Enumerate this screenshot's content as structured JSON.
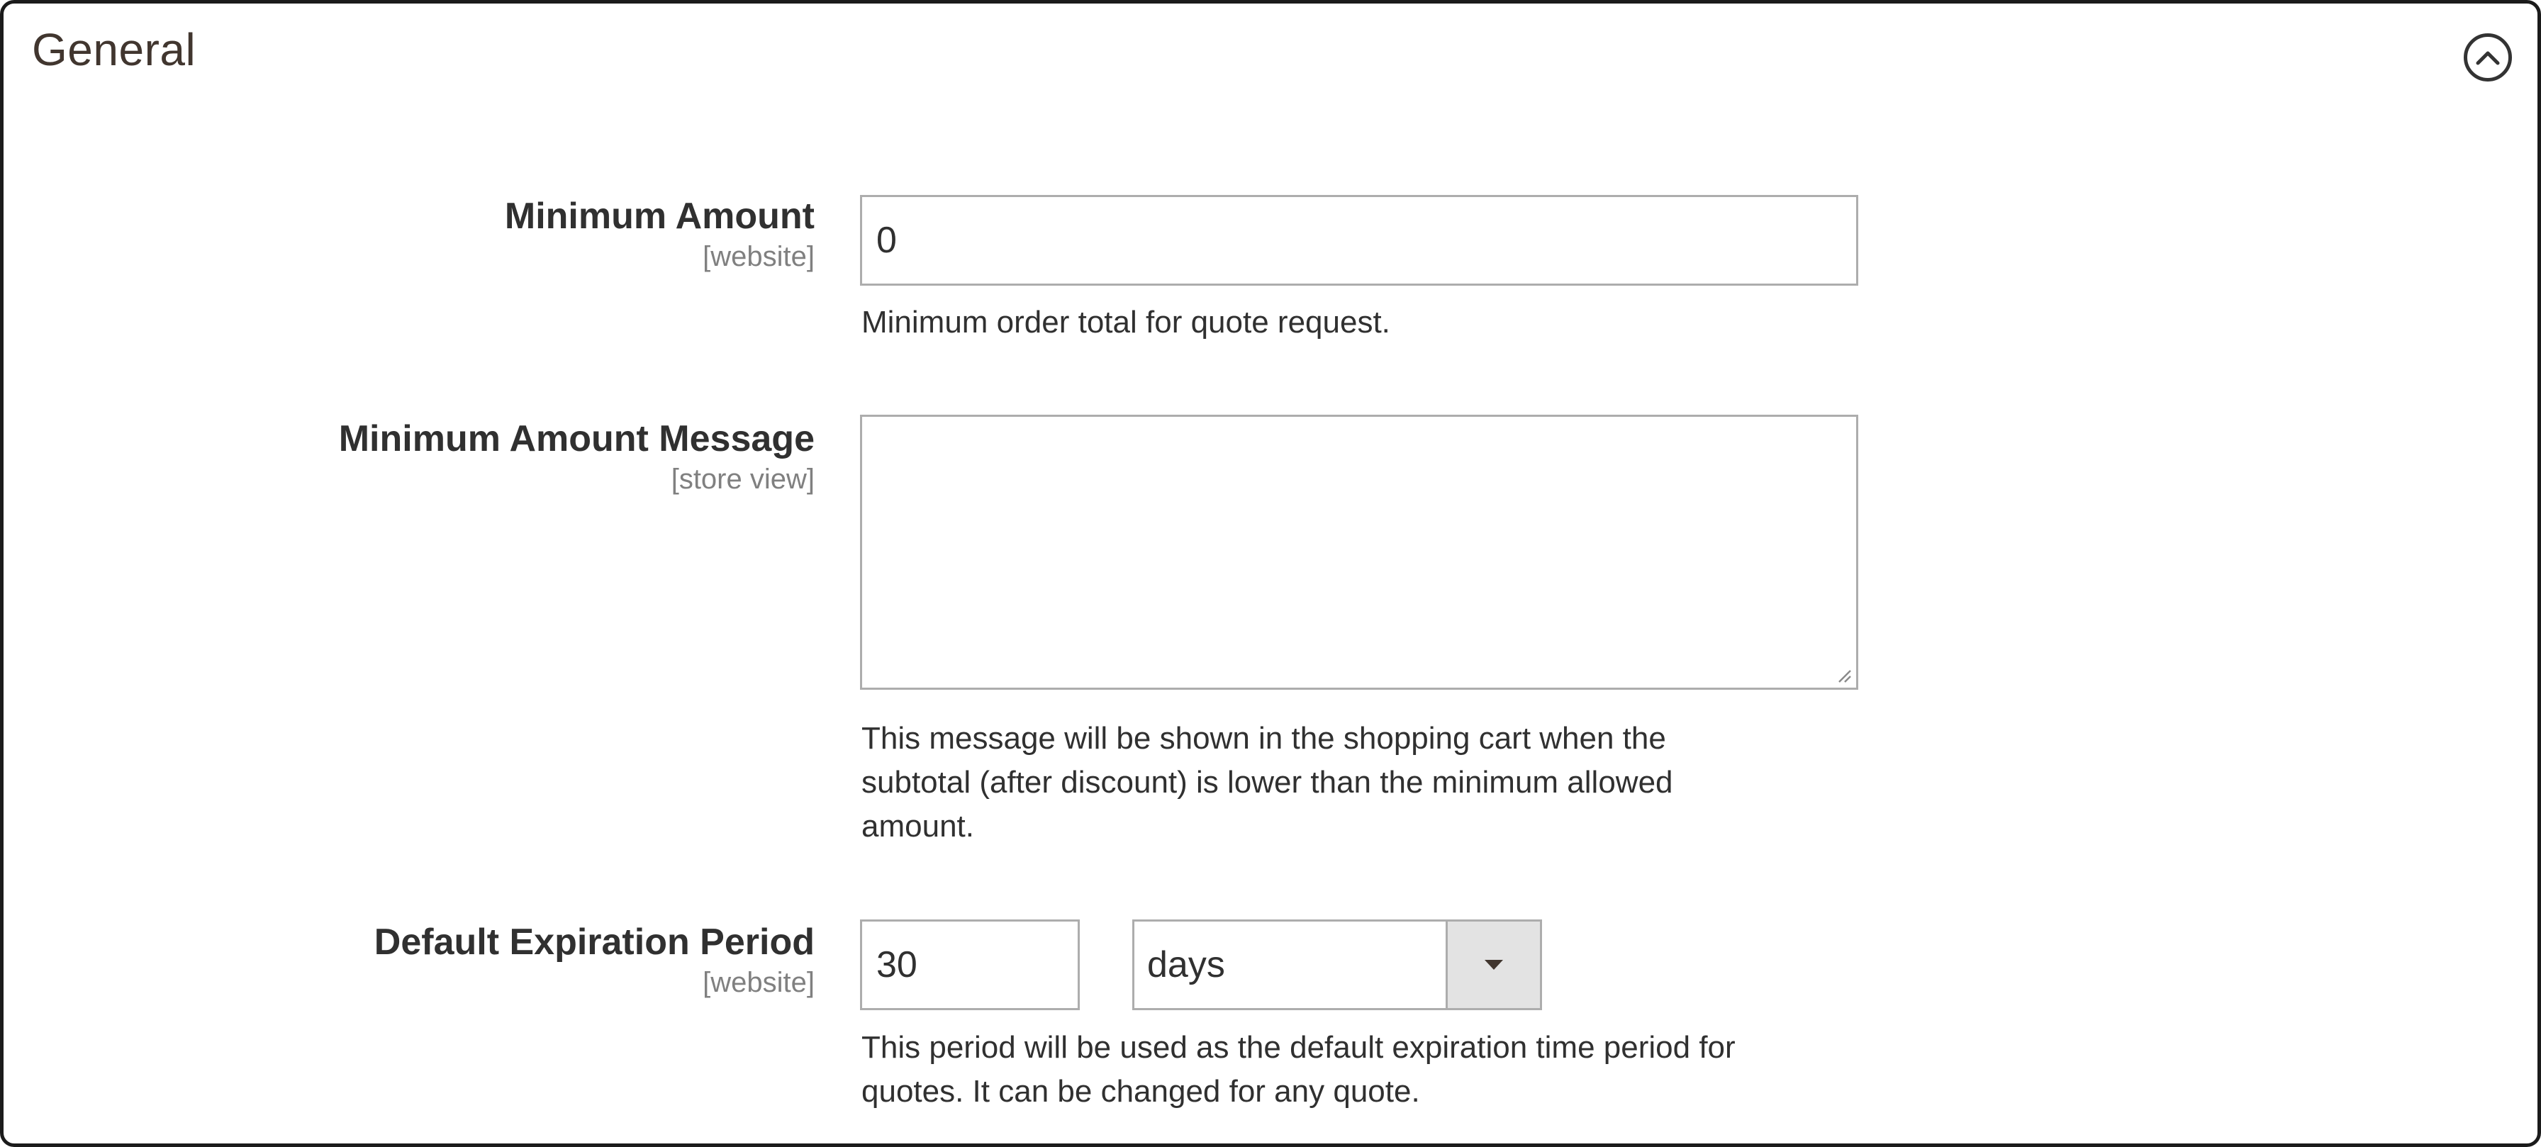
{
  "section": {
    "title": "General",
    "collapse_icon": "chevron-up-circle-icon"
  },
  "fields": {
    "minimum_amount": {
      "label": "Minimum Amount",
      "scope": "[website]",
      "value": "0",
      "note": "Minimum order total for quote request."
    },
    "minimum_amount_message": {
      "label": "Minimum Amount Message",
      "scope": "[store view]",
      "value": "",
      "note_line1": "This message will be shown in the shopping cart when the",
      "note_line2": "subtotal (after discount) is lower than the minimum allowed",
      "note_line3": "amount."
    },
    "default_expiration_period": {
      "label": "Default Expiration Period",
      "scope": "[website]",
      "value": "30",
      "unit_selected": "days",
      "note_line1": "This period will be used as the default expiration time period for",
      "note_line2": "quotes. It can be changed for any quote."
    }
  },
  "colors": {
    "border": "#adadad",
    "frame": "#1b1b1b",
    "select_arrow_bg": "#e3e3e3",
    "scope_text": "#808080"
  }
}
